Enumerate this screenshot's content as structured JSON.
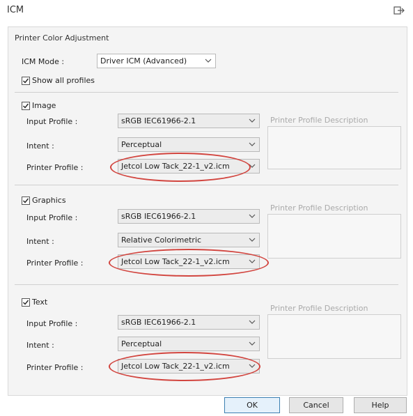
{
  "window": {
    "title": "ICM"
  },
  "group_title": "Printer Color Adjustment",
  "icm_mode": {
    "label": "ICM Mode :",
    "value": "Driver ICM (Advanced)"
  },
  "show_all_profiles": {
    "label": "Show all profiles",
    "checked": true
  },
  "sections": [
    {
      "name": "Image",
      "checked": true,
      "input_profile_label": "Input Profile :",
      "input_profile": "sRGB IEC61966-2.1",
      "intent_label": "Intent :",
      "intent": "Perceptual",
      "printer_profile_label": "Printer Profile :",
      "printer_profile": "Jetcol Low Tack_22-1_v2.icm",
      "desc_title": "Printer Profile Description"
    },
    {
      "name": "Graphics",
      "checked": true,
      "input_profile_label": "Input Profile :",
      "input_profile": "sRGB IEC61966-2.1",
      "intent_label": "Intent :",
      "intent": "Relative Colorimetric",
      "printer_profile_label": "Printer Profile :",
      "printer_profile": "Jetcol Low Tack_22-1_v2.icm",
      "desc_title": "Printer Profile Description"
    },
    {
      "name": "Text",
      "checked": true,
      "input_profile_label": "Input Profile :",
      "input_profile": "sRGB IEC61966-2.1",
      "intent_label": "Intent :",
      "intent": "Perceptual",
      "printer_profile_label": "Printer Profile :",
      "printer_profile": "Jetcol Low Tack_22-1_v2.icm",
      "desc_title": "Printer Profile Description"
    }
  ],
  "buttons": {
    "ok": "OK",
    "cancel": "Cancel",
    "help": "Help"
  },
  "colors": {
    "highlight_ring": "#d2453f",
    "default_button_border": "#3c7fb1"
  },
  "icons": {
    "close": "exit-icon",
    "dropdown": "chevron-down-icon",
    "checkbox": "checkmark-icon"
  }
}
